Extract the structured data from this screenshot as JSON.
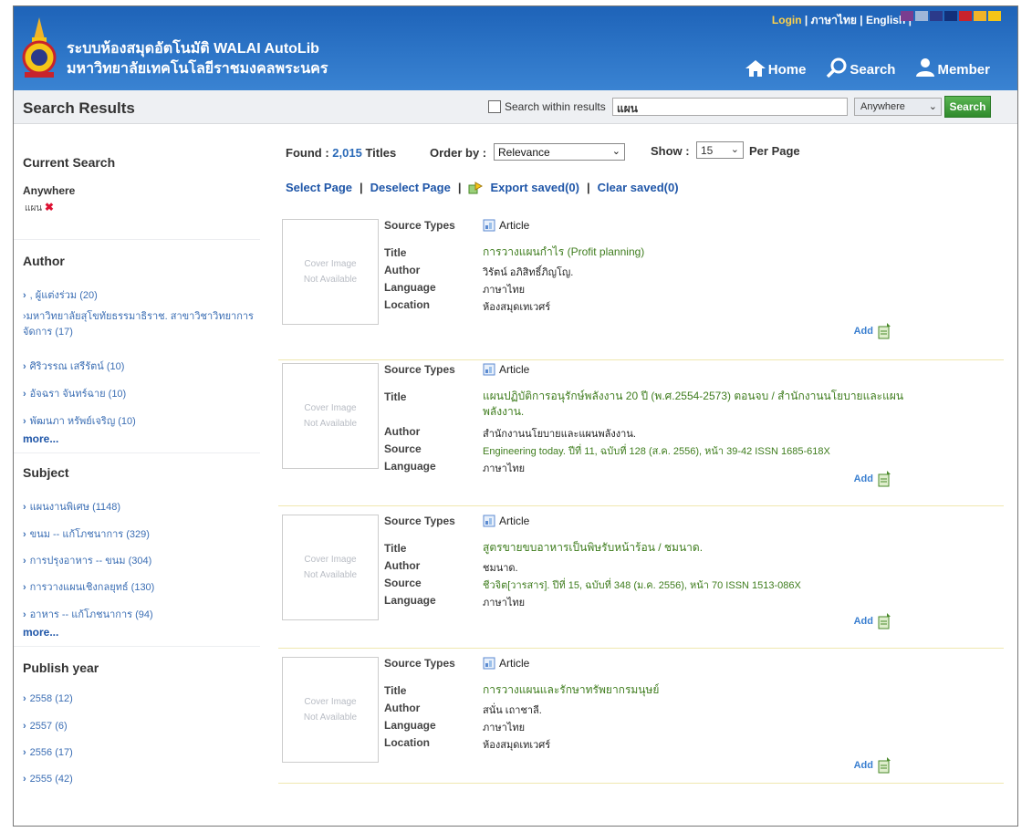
{
  "header": {
    "title": "ระบบห้องสมุดอัตโนมัติ WALAI AutoLib",
    "subtitle": "มหาวิทยาลัยเทคโนโลยีราชมงคลพระนคร",
    "links": {
      "login": "Login",
      "thai": "ภาษาไทย",
      "english": "English",
      "sep": "|"
    },
    "swatch_colors": [
      "#7a3d8f",
      "#9fb7d8",
      "#2b3a8a",
      "#12307a",
      "#c8232c",
      "#f0b429",
      "#f5c518"
    ],
    "nav": {
      "home": "Home",
      "search": "Search",
      "member": "Member"
    }
  },
  "search_bar": {
    "heading": "Search Results",
    "within_label": "Search within results",
    "query": "แผน",
    "field": "Anywhere",
    "button": "Search"
  },
  "sidebar": {
    "current_search": {
      "heading": "Current Search",
      "label": "Anywhere",
      "term": "แผน"
    },
    "author": {
      "heading": "Author",
      "items": [
        ", ผู้แต่งร่วม (20)",
        "มหาวิทยาลัยสุโขทัยธรรมาธิราช. สาขาวิชาวิทยาการจัดการ (17)",
        "ศิริวรรณ เสรีรัตน์ (10)",
        "อัจฉรา จันทร์ฉาย (10)",
        "พัฒนภา หรัพย์เจริญ (10)"
      ],
      "more": "more..."
    },
    "subject": {
      "heading": "Subject",
      "items": [
        "แผนงานพิเศษ (1148)",
        "ขนม -- แก้โภชนาการ (329)",
        "การปรุงอาหาร -- ขนม (304)",
        "การวางแผนเชิงกลยุทธ์ (130)",
        "อาหาร -- แก้โภชนาการ (94)"
      ],
      "more": "more..."
    },
    "publish_year": {
      "heading": "Publish year",
      "items": [
        "2558 (12)",
        "2557 (6)",
        "2556 (17)",
        "2555 (42)"
      ]
    }
  },
  "results": {
    "found_label": "Found :",
    "found_count": "2,015",
    "found_unit": "Titles",
    "order_label": "Order by :",
    "order_value": "Relevance",
    "show_label": "Show :",
    "show_value": "15",
    "per_page": "Per Page",
    "actions": {
      "select": "Select Page",
      "deselect": "Deselect Page",
      "export": "Export saved(0)",
      "clear": "Clear saved(0)",
      "sep": "|"
    },
    "cover": {
      "line1": "Cover Image",
      "line2": "Not Available"
    },
    "add_label": "Add",
    "records": [
      {
        "source_type": "Article",
        "labels": {
          "source_types": "Source Types",
          "title": "Title",
          "author": "Author",
          "language": "Language",
          "location": "Location"
        },
        "title": "การวางแผนกำไร (Profit planning)",
        "author": "วิรัตน์ อภิสิทธิ์ภิญโญ.",
        "language": "ภาษาไทย",
        "location": "ห้องสมุดเทเวศร์"
      },
      {
        "source_type": "Article",
        "labels": {
          "source_types": "Source Types",
          "title": "Title",
          "author": "Author",
          "source": "Source",
          "language": "Language"
        },
        "title": "แผนปฏิบัติการอนุรักษ์พลังงาน 20 ปี (พ.ศ.2554-2573) ตอนจบ / สำนักงานนโยบายและแผนพลังงาน.",
        "author": "สำนักงานนโยบายและแผนพลังงาน.",
        "source": "Engineering today. ปีที่ 11, ฉบับที่ 128 (ส.ค. 2556), หน้า 39-42 ISSN 1685-618X",
        "language": "ภาษาไทย"
      },
      {
        "source_type": "Article",
        "labels": {
          "source_types": "Source Types",
          "title": "Title",
          "author": "Author",
          "source": "Source",
          "language": "Language"
        },
        "title": "สูตรขายขบอาหารเป็นพิษรับหน้าร้อน / ชมนาด.",
        "author": "ชมนาด.",
        "source": "ชีวจิต[วารสาร]. ปีที่ 15, ฉบับที่ 348 (ม.ค. 2556), หน้า 70 ISSN 1513-086X",
        "language": "ภาษาไทย"
      },
      {
        "source_type": "Article",
        "labels": {
          "source_types": "Source Types",
          "title": "Title",
          "author": "Author",
          "language": "Language",
          "location": "Location"
        },
        "title": "การวางแผนและรักษาทรัพยากรมนุษย์",
        "author": "สนั่น เถาชาลี.",
        "language": "ภาษาไทย",
        "location": "ห้องสมุดเทเวศร์"
      }
    ]
  }
}
